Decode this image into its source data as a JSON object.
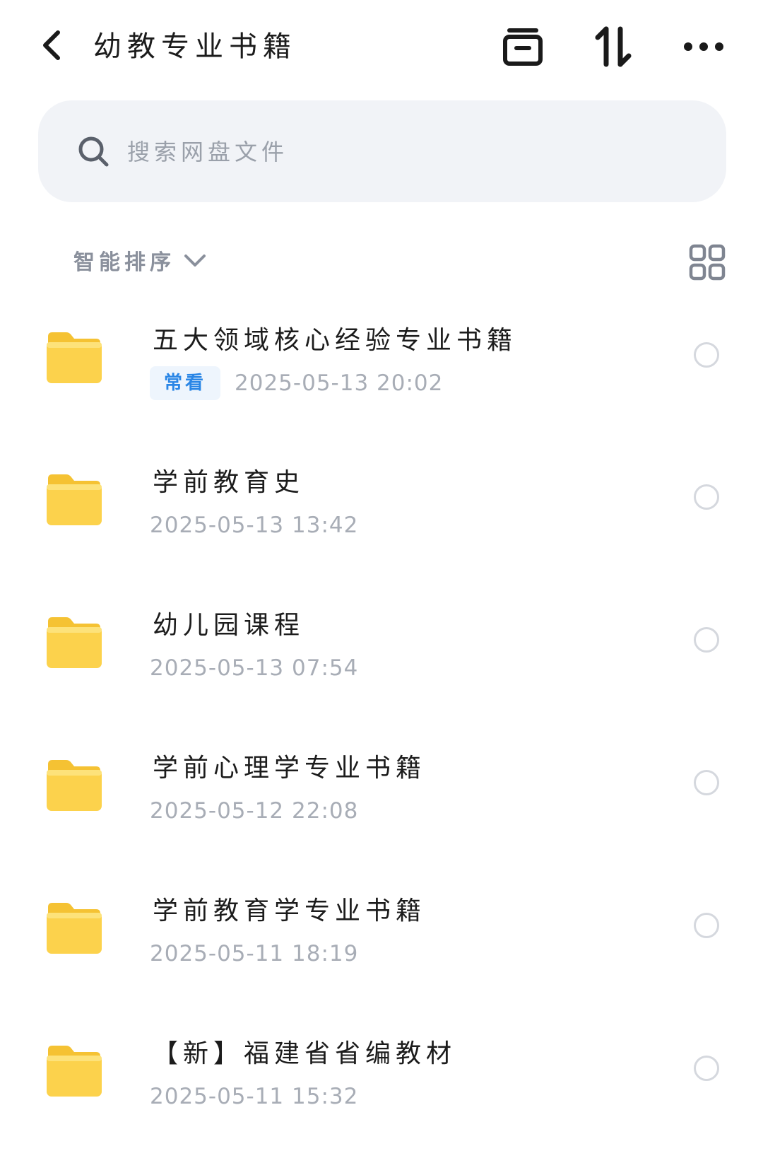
{
  "header": {
    "title": "幼教专业书籍",
    "back_icon": "chevron-left-icon",
    "archive_icon": "archive-box-icon",
    "transfer_icon": "transfer-arrows-icon",
    "more_icon": "more-dots-icon"
  },
  "search": {
    "placeholder": "搜索网盘文件",
    "value": "",
    "icon": "search-icon"
  },
  "sort": {
    "label": "智能排序",
    "chevron_icon": "chevron-down-icon",
    "view_icon": "grid-view-icon"
  },
  "colors": {
    "folder": "#fcd14a",
    "badge_text": "#2a86e6",
    "badge_bg": "#eef5fd",
    "muted_text": "#a8adb6"
  },
  "files": [
    {
      "name": "五大领域核心经验专业书籍",
      "badge": "常看",
      "time": "2025-05-13  20:02"
    },
    {
      "name": "学前教育史",
      "badge": "",
      "time": "2025-05-13  13:42"
    },
    {
      "name": "幼儿园课程",
      "badge": "",
      "time": "2025-05-13  07:54"
    },
    {
      "name": "学前心理学专业书籍",
      "badge": "",
      "time": "2025-05-12  22:08"
    },
    {
      "name": "学前教育学专业书籍",
      "badge": "",
      "time": "2025-05-11  18:19"
    },
    {
      "name": "【新】福建省省编教材",
      "badge": "",
      "time": "2025-05-11  15:32"
    }
  ]
}
